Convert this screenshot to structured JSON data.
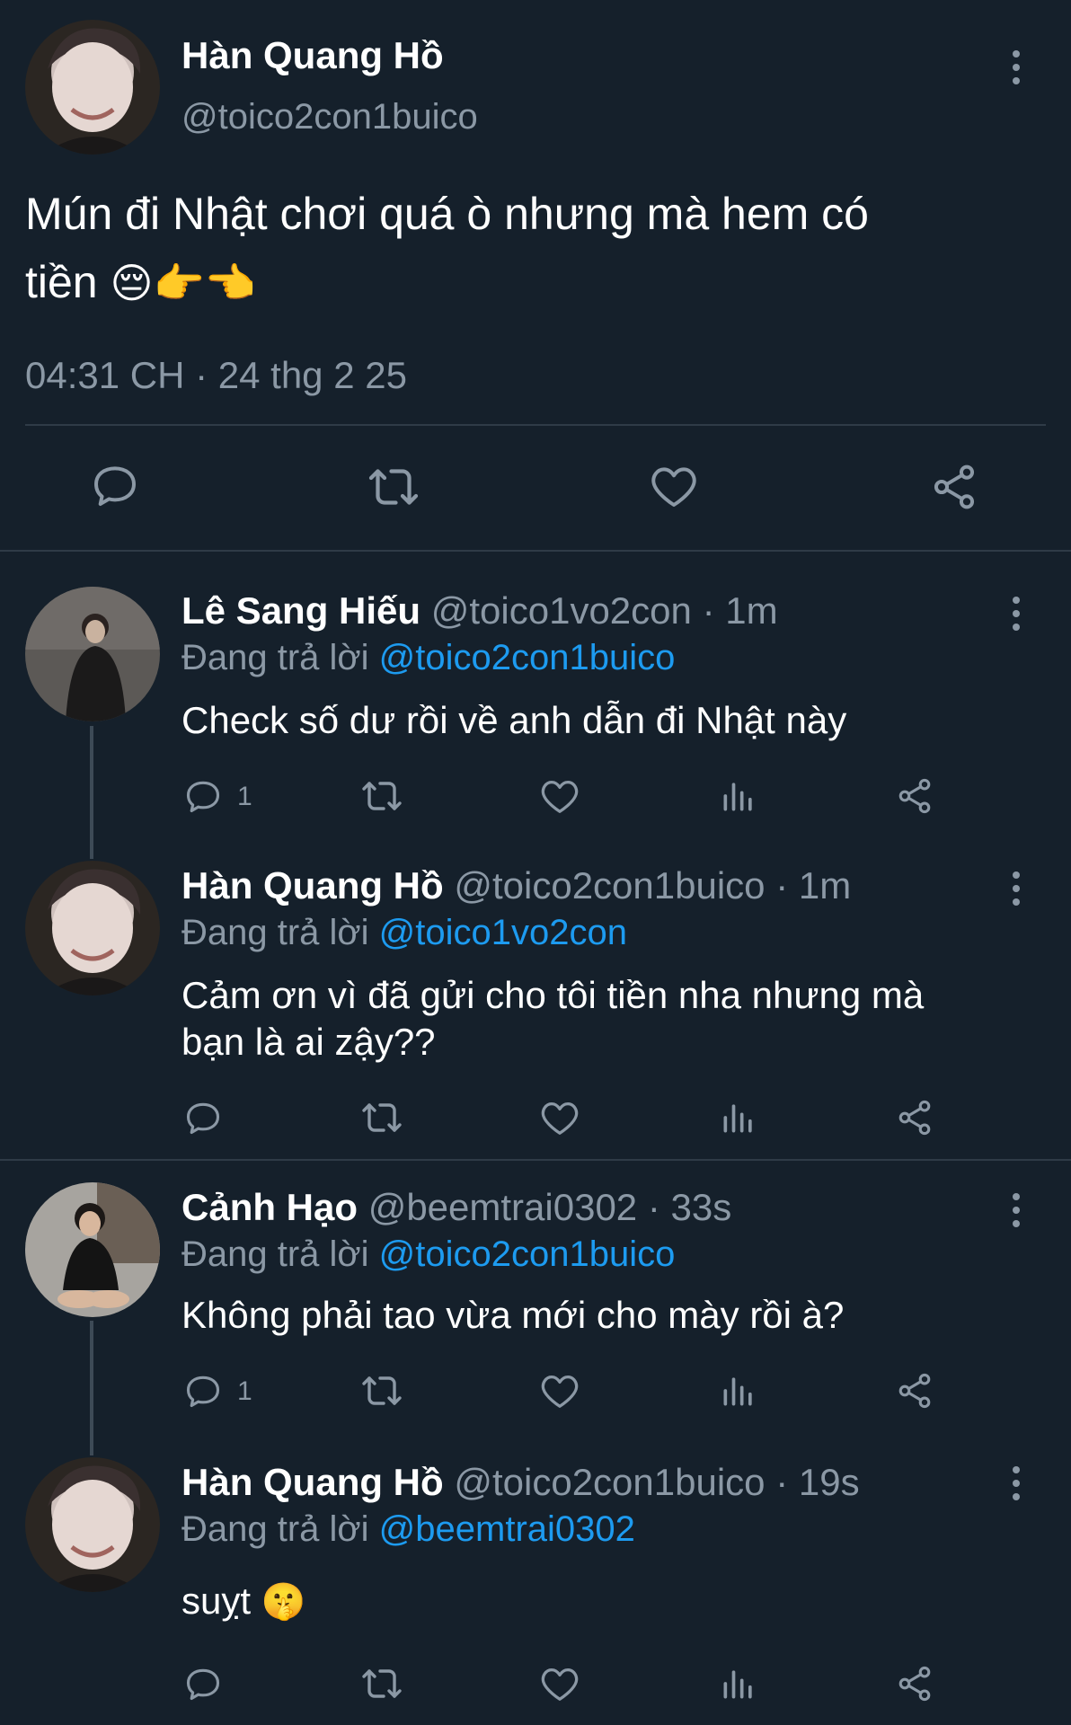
{
  "main_tweet": {
    "author_name": "Hàn Quang Hồ",
    "handle": "@toico2con1buico",
    "text": "Mún đi Nhật chơi quá ò nhưng mà hem có",
    "text_line2": "tiền",
    "emojis": "😔👉👈",
    "timestamp": "04:31 CH · 24 thg 2 25",
    "icons": [
      "reply-icon",
      "retweet-icon",
      "like-icon",
      "share-icon"
    ]
  },
  "replies": [
    {
      "author_name": "Lê Sang Hiếu",
      "handle": "@toico1vo2con",
      "time": "· 1m",
      "replying_to_label": "Đang trả lời",
      "replying_to": "@toico2con1buico",
      "text": "Check số dư rồi về anh dẫn đi Nhật này",
      "reply_count": "1"
    },
    {
      "author_name": "Hàn Quang Hồ",
      "handle": "@toico2con1buico",
      "time": "· 1m",
      "replying_to_label": "Đang trả lời",
      "replying_to": "@toico1vo2con",
      "text": "Cảm ơn vì đã gửi cho tôi tiền nha nhưng mà",
      "text_line2": "bạn là ai zậy??",
      "reply_count": ""
    },
    {
      "author_name": "Cảnh Hạo",
      "handle": "@beemtrai0302",
      "time": "· 33s",
      "replying_to_label": "Đang trả lời",
      "replying_to": "@toico2con1buico",
      "text": "Không phải tao vừa mới cho mày rồi à?",
      "reply_count": "1"
    },
    {
      "author_name": "Hàn Quang Hồ",
      "handle": "@toico2con1buico",
      "time": "· 19s",
      "replying_to_label": "Đang trả lời",
      "replying_to": "@beemtrai0302",
      "text": "suỵt",
      "emoji": "🤫",
      "reply_count": ""
    }
  ],
  "colors": {
    "background": "#15202b",
    "text": "#ffffff",
    "muted": "#8b98a5",
    "link": "#1d9bf0",
    "divider": "#2f3b47"
  }
}
